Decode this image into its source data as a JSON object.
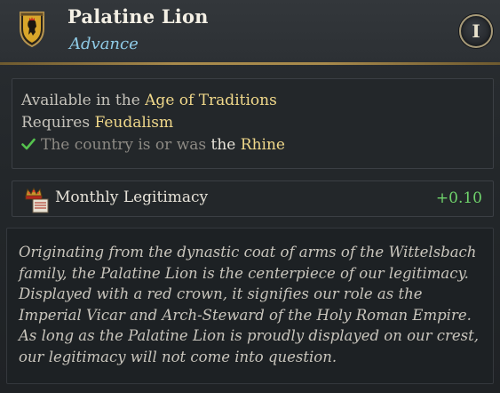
{
  "header": {
    "title": "Palatine Lion",
    "subtitle": "Advance",
    "info_button_label": "I",
    "crest_icon": "shield-icon"
  },
  "requirements": {
    "age_prefix": "Available in the ",
    "age_value": "Age of Traditions",
    "requires_prefix": "Requires ",
    "requires_value": "Feudalism",
    "condition_check_icon": "check-icon",
    "condition_text": "The country is or was ",
    "condition_the": "the ",
    "condition_value": "Rhine",
    "condition_met": true
  },
  "modifier": {
    "icon": "legitimacy-icon",
    "label": "Monthly Legitimacy",
    "value": "+0.10"
  },
  "description": {
    "lines": [
      "Originating from the dynastic coat of arms of the Wittelsbach",
      "family, the Palatine Lion is the centerpiece of our legitimacy.",
      "Displayed with a red crown, it signifies our role as the",
      "Imperial Vicar and Arch-Steward of the Holy Roman Empire.",
      "As long as the Palatine Lion is proudly displayed on our crest,",
      "our legitimacy will not come into question."
    ]
  },
  "colors": {
    "title": "#f3efe4",
    "subtitle": "#8fcbe6",
    "highlight": "#f0d88a",
    "positive": "#6fd36b",
    "divider_gold": "#a88a4c"
  }
}
